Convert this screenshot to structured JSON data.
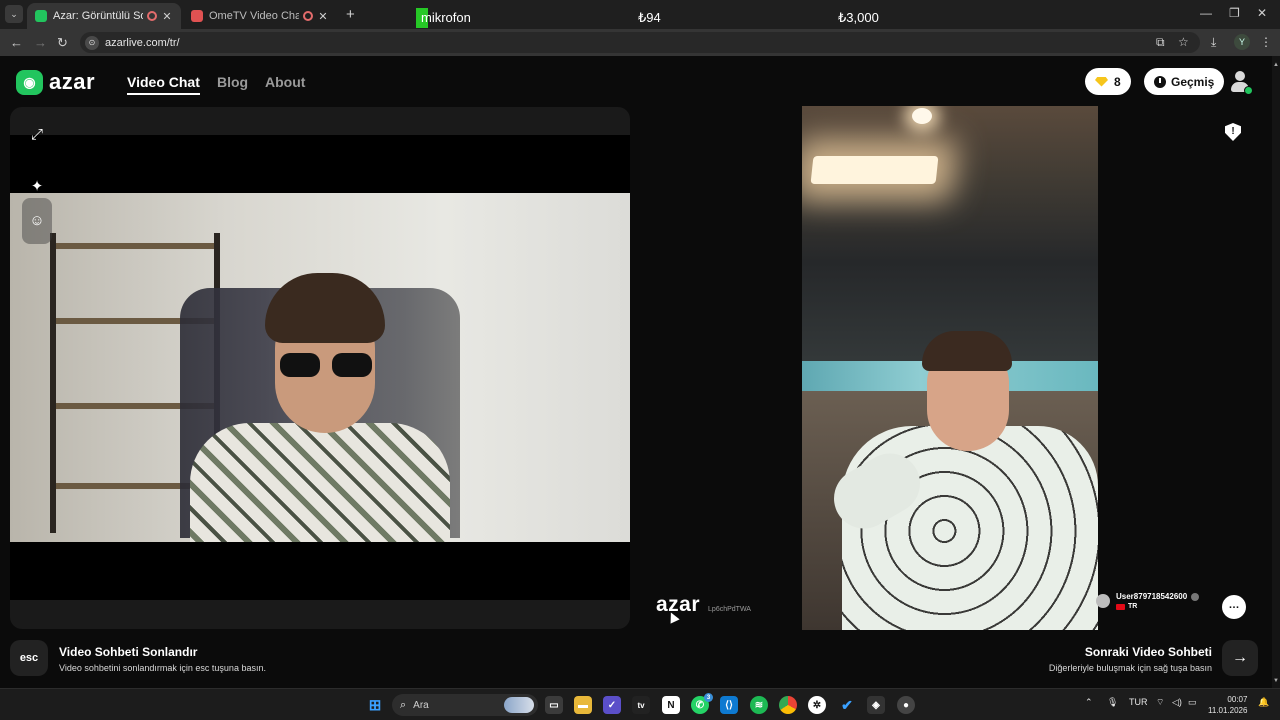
{
  "browser": {
    "tabs": [
      {
        "title": "Azar: Görüntülü Sohbet & Y",
        "active": true
      },
      {
        "title": "OmeTV Video Chat — Ome",
        "active": false
      }
    ],
    "url": "azarlive.com/tr/",
    "profile_initial": "Y",
    "overlays": {
      "mic": "mikrofon",
      "stat1": "₺94",
      "stat2": "₺3,000"
    }
  },
  "header": {
    "logo": "azar",
    "nav": [
      "Video Chat",
      "Blog",
      "About"
    ],
    "gems": "8",
    "history_label": "Geçmiş"
  },
  "partner": {
    "username": "User879718542600",
    "country": "TR"
  },
  "watermark": {
    "logo": "azar",
    "id": "Lp6chPdTWA"
  },
  "footer": {
    "esc_key": "esc",
    "end_title": "Video Sohbeti Sonlandır",
    "end_sub": "Video sohbetini sonlandırmak için esc tuşuna basın.",
    "next_title": "Sonraki Video Sohbeti",
    "next_sub": "Diğerleriyle buluşmak için sağ tuşa basın",
    "next_key": "→"
  },
  "taskbar": {
    "search_placeholder": "Ara",
    "whatsapp_badge": "3",
    "language": "TUR",
    "time": "00:07",
    "date": "11.01.2026"
  },
  "colors": {
    "brand": "#22c55e",
    "gem": "#f6c51b"
  }
}
